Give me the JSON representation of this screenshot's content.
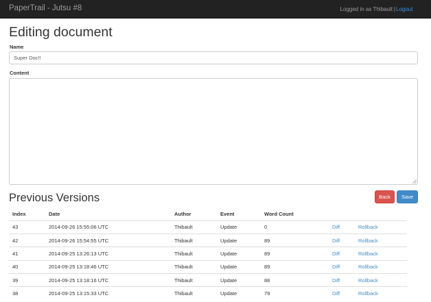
{
  "navbar": {
    "brand": "PaperTrail - Jutsu #8",
    "logged_in_text": "Logged in as Thibault",
    "separator": "|",
    "logout_label": "Logout"
  },
  "page": {
    "title": "Editing document"
  },
  "form": {
    "name_label": "Name",
    "name_value": "Super Doc!!",
    "content_label": "Content",
    "content_value": ""
  },
  "versions": {
    "title": "Previous Versions",
    "back_label": "Back",
    "save_label": "Save",
    "columns": [
      "Index",
      "Date",
      "Author",
      "Event",
      "Word Count"
    ],
    "rows": [
      {
        "index": "43",
        "date": "2014-09-26 15:55:06 UTC",
        "author": "Thibault",
        "event": "Update",
        "word_count": "0",
        "diff": "Diff",
        "rollback": "Rollback"
      },
      {
        "index": "42",
        "date": "2014-09-26 15:54:55 UTC",
        "author": "Thibault",
        "event": "Update",
        "word_count": "89",
        "diff": "Diff",
        "rollback": "Rollback"
      },
      {
        "index": "41",
        "date": "2014-09-25 13:26:13 UTC",
        "author": "Thibault",
        "event": "Update",
        "word_count": "89",
        "diff": "Diff",
        "rollback": "Rollback"
      },
      {
        "index": "40",
        "date": "2014-09-25 13:18:46 UTC",
        "author": "Thibault",
        "event": "Update",
        "word_count": "89",
        "diff": "Diff",
        "rollback": "Rollback"
      },
      {
        "index": "39",
        "date": "2014-09-25 13:18:16 UTC",
        "author": "Thibault",
        "event": "Update",
        "word_count": "88",
        "diff": "Diff",
        "rollback": "Rollback"
      },
      {
        "index": "38",
        "date": "2014-09-25 13:15:33 UTC",
        "author": "Thibault",
        "event": "Update",
        "word_count": "79",
        "diff": "Diff",
        "rollback": "Rollback"
      }
    ]
  },
  "colors": {
    "navbar_bg": "#222222",
    "link": "#428bca",
    "danger": "#d9534f",
    "primary": "#428bca"
  }
}
